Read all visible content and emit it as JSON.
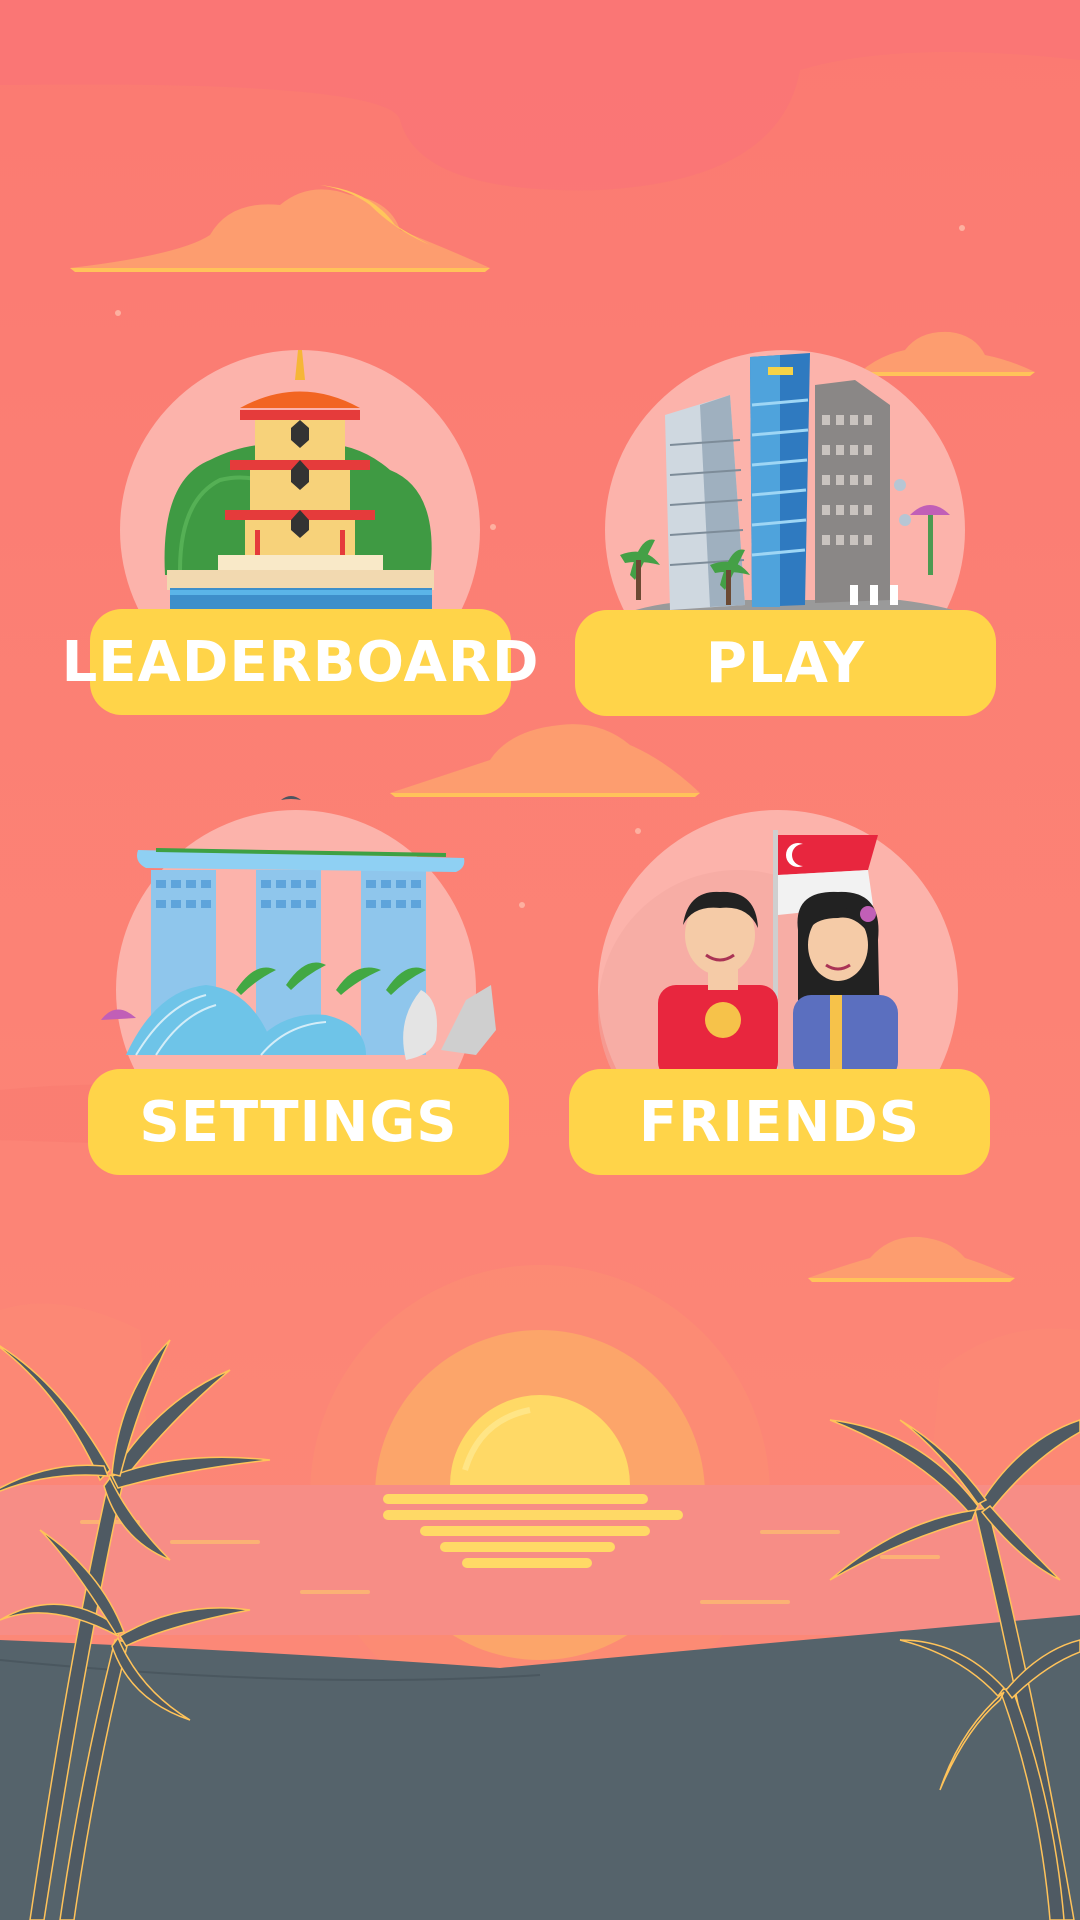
{
  "menu": {
    "leaderboard": {
      "label": "LEADERBOARD",
      "icon": "pagoda-icon"
    },
    "play": {
      "label": "PLAY",
      "icon": "skyscrapers-icon"
    },
    "settings": {
      "label": "SETTINGS",
      "icon": "marina-bay-sands-icon"
    },
    "friends": {
      "label": "FRIENDS",
      "icon": "couple-with-flag-icon"
    }
  },
  "colors": {
    "sky": "#fb7b74",
    "button": "#ffd449",
    "button_text": "#ffffff",
    "circle": "#fcb3ab",
    "sea": "#f78b85",
    "sand": "#52636d",
    "sun": "#ffd966",
    "palm": "#4f5a63"
  }
}
